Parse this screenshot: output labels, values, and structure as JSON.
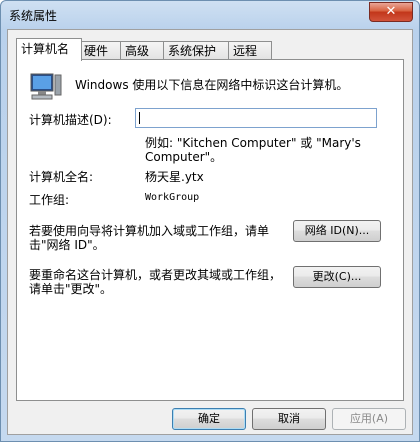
{
  "window": {
    "title": "系统属性",
    "close_symbol": "✕"
  },
  "tabs": [
    "计算机名",
    "硬件",
    "高级",
    "系统保护",
    "远程"
  ],
  "panel": {
    "intro": "Windows 使用以下信息在网络中标识这台计算机。",
    "desc_label": "计算机描述(D):",
    "desc_value": "",
    "example_line1": "例如: \"Kitchen Computer\" 或 \"Mary's",
    "example_line2": "Computer\"。",
    "fullname_label": "计算机全名:",
    "fullname_value": "杨天星.ytx",
    "workgroup_label": "工作组:",
    "workgroup_value": "WorkGroup",
    "join_text_line1": "若要使用向导将计算机加入域或工作组，请单",
    "join_text_line2": "击\"网络 ID\"。",
    "network_id_button": "网络 ID(N)...",
    "rename_text_line1": "要重命名这台计算机，或者更改其域或工作组，",
    "rename_text_line2": "请单击\"更改\"。",
    "change_button": "更改(C)..."
  },
  "footer": {
    "ok": "确定",
    "cancel": "取消",
    "apply": "应用(A)"
  }
}
